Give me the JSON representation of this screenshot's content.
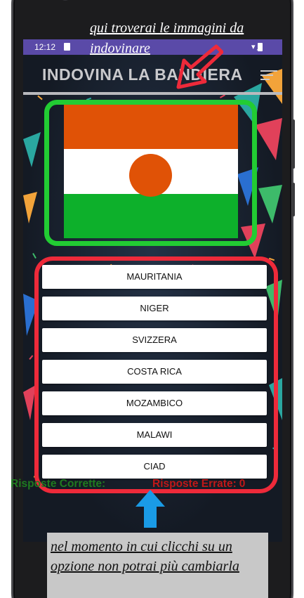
{
  "status_bar": {
    "time": "12:12",
    "icons": "▾◢"
  },
  "app": {
    "title": "INDOVINA LA BANDIERA"
  },
  "flag": {
    "country": "Niger",
    "colors": {
      "top": "#e05206",
      "middle": "#ffffff",
      "bottom": "#0db02b",
      "disc": "#e05206"
    }
  },
  "options": [
    {
      "label": "MAURITANIA"
    },
    {
      "label": "NIGER"
    },
    {
      "label": "SVIZZERA"
    },
    {
      "label": "COSTA RICA"
    },
    {
      "label": "MOZAMBICO"
    },
    {
      "label": "MALAWI"
    },
    {
      "label": "CIAD"
    }
  ],
  "score": {
    "correct_label": "Risposte Corrette:",
    "correct_value": "",
    "wrong_label": "Risposte Errate:",
    "wrong_value": "0"
  },
  "annotations": {
    "top_note": "qui troverai le immagini da indovinare",
    "bottom_note": "nel momento in cui clicchi su un opzione non potrai più cambiarla"
  },
  "colors": {
    "highlight_image": "#22cc33",
    "highlight_options": "#ee2a3a",
    "arrow_top": "#ee2a3a",
    "arrow_bottom": "#1a9be6",
    "status_bar": "#5a4aa8",
    "correct_text": "#1f7a1f",
    "wrong_text": "#c01818"
  }
}
